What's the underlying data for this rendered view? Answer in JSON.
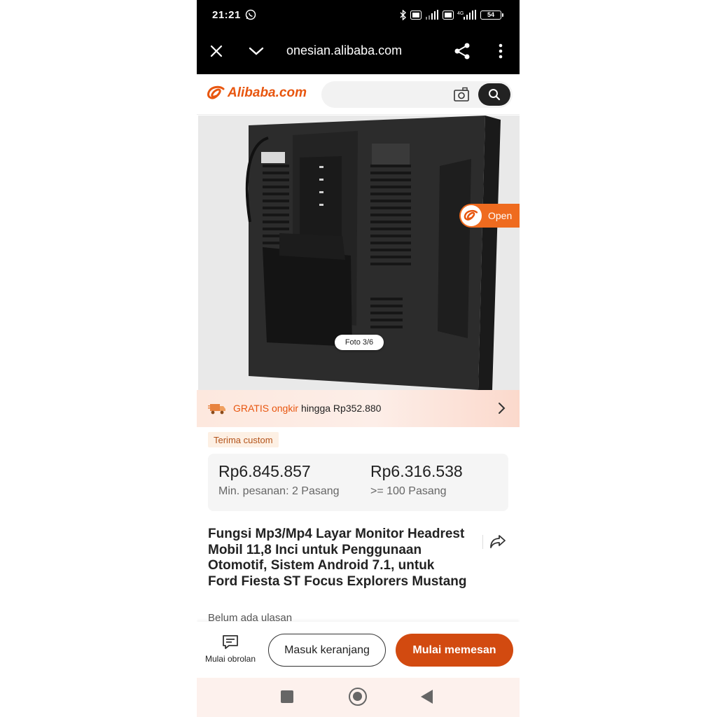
{
  "status_bar": {
    "time": "21:21",
    "battery": "54"
  },
  "browser": {
    "url": "onesian.alibaba.com"
  },
  "header": {
    "logo_text": "Alibaba.com",
    "search_placeholder": ""
  },
  "gallery": {
    "photo_counter": "Foto 3/6",
    "open_label": "Open"
  },
  "shipping": {
    "highlight": "GRATIS ongkir",
    "rest": " hingga Rp352.880"
  },
  "custom_tag": "Terima custom",
  "prices": [
    {
      "price": "Rp6.845.857",
      "qty": "Min. pesanan: 2 Pasang"
    },
    {
      "price": "Rp6.316.538",
      "qty": ">= 100 Pasang"
    }
  ],
  "product": {
    "title": "Fungsi Mp3/Mp4 Layar Monitor Headrest Mobil 11,8 Inci untuk Penggunaan Otomotif, Sistem Android 7.1, untuk Ford Fiesta ST Focus Explorers Mustang",
    "reviews": "Belum ada ulasan"
  },
  "actions": {
    "chat_label": "Mulai obrolan",
    "cart_label": "Masuk keranjang",
    "order_label": "Mulai memesan"
  },
  "colors": {
    "brand": "#e8560f",
    "order_button": "#d24a10",
    "open_badge": "#ef6b1f"
  },
  "icons": [
    "whatsapp-icon",
    "bluetooth-icon",
    "signal-icon",
    "close-icon",
    "chevron-down-icon",
    "share-icon",
    "more-icon",
    "camera-icon",
    "search-icon",
    "truck-icon",
    "chevron-right-icon",
    "forward-share-icon",
    "chat-icon"
  ]
}
